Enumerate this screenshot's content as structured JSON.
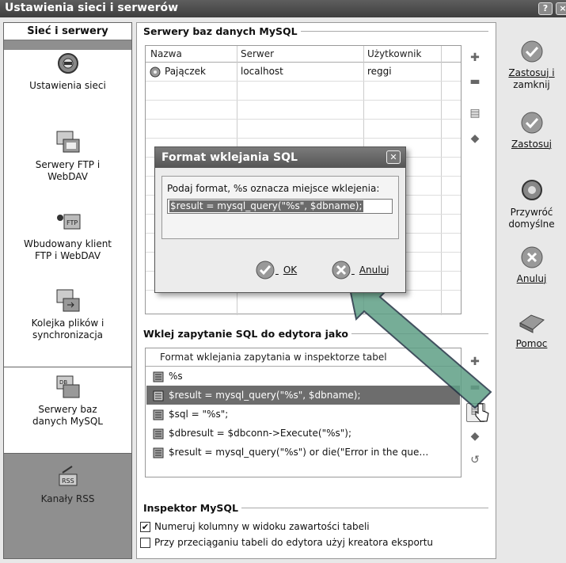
{
  "window": {
    "title": "Ustawienia sieci i serwerów",
    "help_glyph": "?",
    "close_glyph": "×"
  },
  "sidebar": {
    "header": "Sieć i serwery",
    "items": [
      {
        "label_l1": "Ustawienia sieci",
        "label_l2": "",
        "icon": "network-settings-icon"
      },
      {
        "label_l1": "Serwery FTP i",
        "label_l2": "WebDAV",
        "icon": "ftp-servers-icon"
      },
      {
        "label_l1": "Wbudowany klient",
        "label_l2": "FTP i WebDAV",
        "icon": "ftp-client-icon"
      },
      {
        "label_l1": "Kolejka plików i",
        "label_l2": "synchronizacja",
        "icon": "file-queue-icon"
      },
      {
        "label_l1": "Serwery baz",
        "label_l2": "danych MySQL",
        "icon": "mysql-servers-icon"
      },
      {
        "label_l1": "Kanały RSS",
        "label_l2": "",
        "icon": "rss-icon"
      }
    ]
  },
  "mysql_servers": {
    "group_title": "Serwery baz danych MySQL",
    "columns": [
      "Nazwa",
      "Serwer",
      "Użytkownik"
    ],
    "rows": [
      {
        "name": "Pajączek",
        "server": "localhost",
        "user": "reggi"
      }
    ]
  },
  "paste_group": {
    "group_title": "Wklej zapytanie SQL do edytora jako",
    "header": "Format wklejania zapytania w inspektorze tabel",
    "rows": [
      "%s",
      "$result = mysql_query(\"%s\", $dbname);",
      "$sql = \"%s\";",
      "$dbresult = $dbconn->Execute(\"%s\");",
      "$result = mysql_query(\"%s\") or die(\"Error in the que…"
    ],
    "selected_index": 1
  },
  "inspector": {
    "group_title": "Inspektor MySQL",
    "options": [
      {
        "label": "Numeruj kolumny w widoku zawartości tabeli",
        "checked": true
      },
      {
        "label": "Przy przeciąganiu tabeli do edytora użyj kreatora eksportu",
        "checked": false
      }
    ]
  },
  "right_buttons": {
    "apply_close_l1": "Zastosuj i",
    "apply_close_l2": "zamknij",
    "apply": "Zastosuj",
    "restore_l1": "Przywróć",
    "restore_l2": "domyślne",
    "cancel": "Anuluj",
    "help": "Pomoc"
  },
  "dialog": {
    "title": "Format wklejania SQL",
    "prompt": "Podaj format, %s oznacza miejsce wklejenia:",
    "value": "$result = mysql_query(\"%s\", $dbname);",
    "ok": "OK",
    "cancel": "Anuluj"
  },
  "colors": {
    "accent_arrow": "#4f9a7d",
    "selection": "#6d6d6d",
    "titlebar": "#4a4a4a"
  }
}
